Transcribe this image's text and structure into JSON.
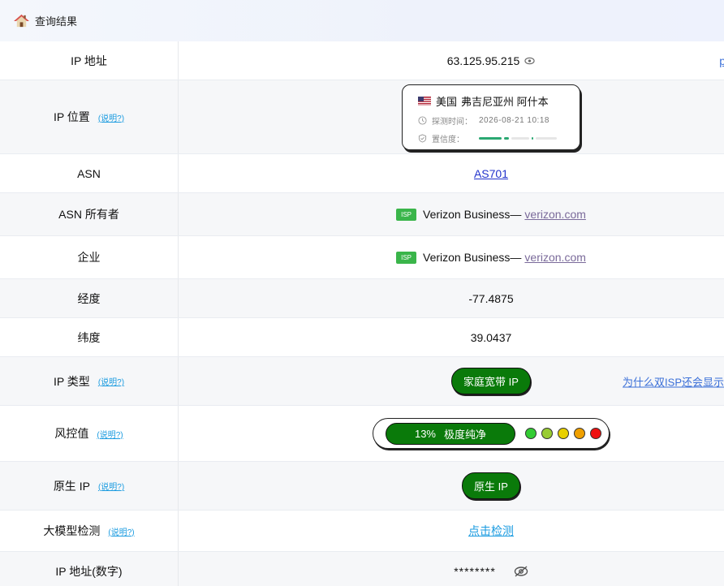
{
  "header": {
    "title": "查询结果",
    "icon": "home-icon"
  },
  "help_label": "(说明?)",
  "rows": {
    "ip": {
      "label": "IP 地址",
      "value": "63.125.95.215",
      "side_link": "p"
    },
    "location": {
      "label": "IP 位置",
      "country": "美国",
      "region": "弗吉尼亚州 阿什本",
      "time_label": "探测时间：",
      "time_value": "2026-08-21 10:18",
      "confidence_label": "置信度：",
      "confidence_level": 0.55
    },
    "asn": {
      "label": "ASN",
      "value": "AS701"
    },
    "asn_owner": {
      "label": "ASN 所有者",
      "badge": "ISP",
      "name": "Verizon Business—",
      "link": "verizon.com"
    },
    "company": {
      "label": "企业",
      "badge": "ISP",
      "name": "Verizon Business—",
      "link": "verizon.com"
    },
    "longitude": {
      "label": "经度",
      "value": "-77.4875"
    },
    "latitude": {
      "label": "纬度",
      "value": "39.0437"
    },
    "ip_type": {
      "label": "IP 类型",
      "value": "家庭宽带 IP",
      "side_link": "为什么双ISP还会显示"
    },
    "risk": {
      "label": "风控值",
      "percent": "13%",
      "level": "极度纯净",
      "dot_colors": [
        "#33cc33",
        "#99cc33",
        "#e8d000",
        "#f0a000",
        "#ee1111"
      ]
    },
    "native_ip": {
      "label": "原生 IP",
      "value": "原生 IP"
    },
    "llm": {
      "label": "大模型检测",
      "value": "点击检测"
    },
    "ip_numeric": {
      "label": "IP 地址(数字)",
      "value": "********"
    }
  },
  "colors": {
    "accent_green": "#0a7a0a",
    "link_blue": "#1a9be0",
    "isp_green": "#3ab54a"
  }
}
